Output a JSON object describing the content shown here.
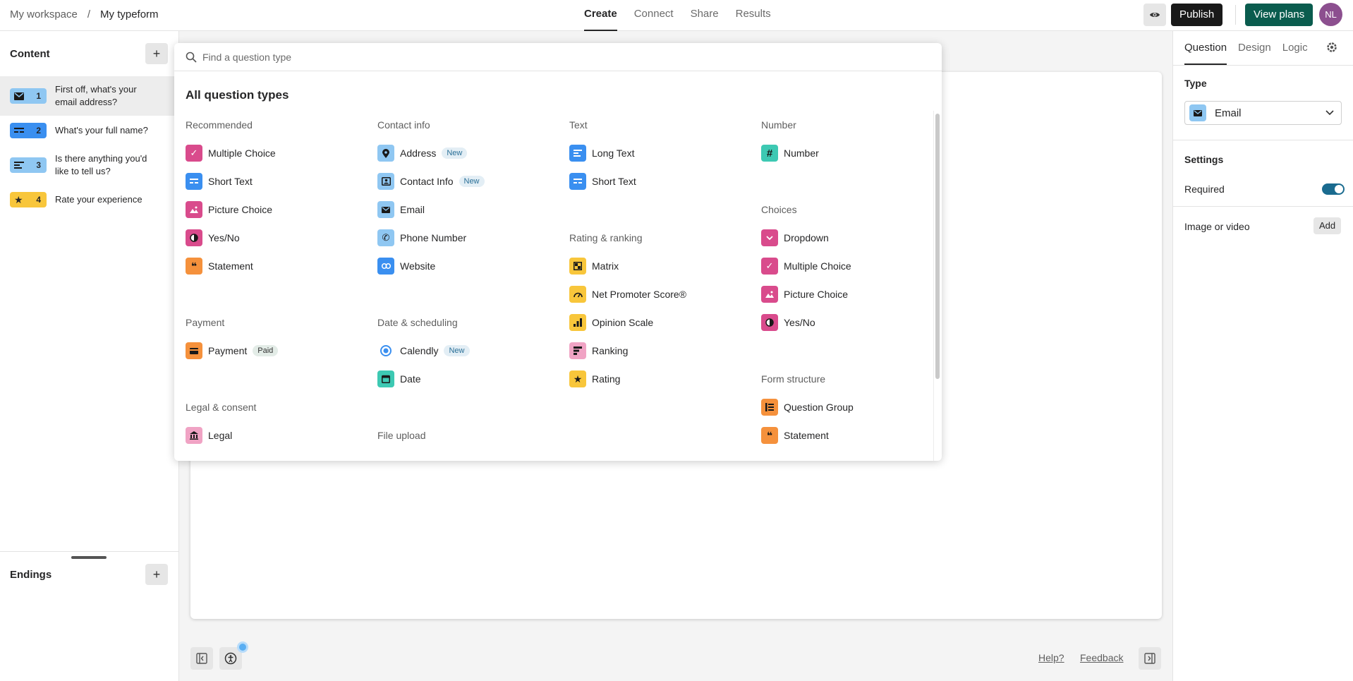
{
  "header": {
    "breadcrumb": {
      "workspace": "My workspace",
      "separator": "/",
      "form": "My typeform"
    },
    "tabs": [
      "Create",
      "Connect",
      "Share",
      "Results"
    ],
    "publish": "Publish",
    "view_plans": "View plans",
    "avatar": "NL"
  },
  "left": {
    "content_title": "Content",
    "endings_title": "Endings",
    "questions": [
      {
        "num": "1",
        "text": "First off, what's your email address?",
        "icon": "mail-icon",
        "color": "#8fc7f2"
      },
      {
        "num": "2",
        "text": "What's your full name?",
        "icon": "short-text-icon",
        "color": "#3a8ff0"
      },
      {
        "num": "3",
        "text": "Is there anything you'd like to tell us?",
        "icon": "long-text-icon",
        "color": "#8fc7f2"
      },
      {
        "num": "4",
        "text": "Rate your experience",
        "icon": "star-icon",
        "color": "#f8c63b"
      }
    ]
  },
  "popup": {
    "search_placeholder": "Find a question type",
    "title": "All question types",
    "sections": {
      "recommended": {
        "title": "Recommended",
        "items": [
          "Multiple Choice",
          "Short Text",
          "Picture Choice",
          "Yes/No",
          "Statement"
        ]
      },
      "contact": {
        "title": "Contact info",
        "items": [
          "Address",
          "Contact Info",
          "Email",
          "Phone Number",
          "Website"
        ]
      },
      "text": {
        "title": "Text",
        "items": [
          "Long Text",
          "Short Text"
        ]
      },
      "number": {
        "title": "Number",
        "items": [
          "Number"
        ]
      },
      "choices": {
        "title": "Choices",
        "items": [
          "Dropdown",
          "Multiple Choice",
          "Picture Choice",
          "Yes/No"
        ]
      },
      "rating": {
        "title": "Rating & ranking",
        "items": [
          "Matrix",
          "Net Promoter Score®",
          "Opinion Scale",
          "Ranking",
          "Rating"
        ]
      },
      "payment": {
        "title": "Payment",
        "items": [
          "Payment"
        ]
      },
      "date": {
        "title": "Date & scheduling",
        "items": [
          "Calendly",
          "Date"
        ]
      },
      "legal": {
        "title": "Legal & consent",
        "items": [
          "Legal"
        ]
      },
      "file": {
        "title": "File upload"
      },
      "structure": {
        "title": "Form structure",
        "items": [
          "Question Group",
          "Statement"
        ]
      }
    },
    "tags": {
      "new": "New",
      "paid": "Paid"
    }
  },
  "footer": {
    "help": "Help?",
    "feedback": "Feedback"
  },
  "right": {
    "tabs": [
      "Question",
      "Design",
      "Logic"
    ],
    "type_label": "Type",
    "type_value": "Email",
    "settings_label": "Settings",
    "required_label": "Required",
    "required_on": true,
    "media_label": "Image or video",
    "add": "Add"
  },
  "colors": {
    "pink": "#d94b8c",
    "blue": "#3a8ff0",
    "lightblue": "#8fc7f2",
    "orange": "#f5913c",
    "yellow": "#f8c63b",
    "teal": "#3dc9b3",
    "lightpink": "#f0a3c4",
    "green": "#0a5c4e"
  }
}
